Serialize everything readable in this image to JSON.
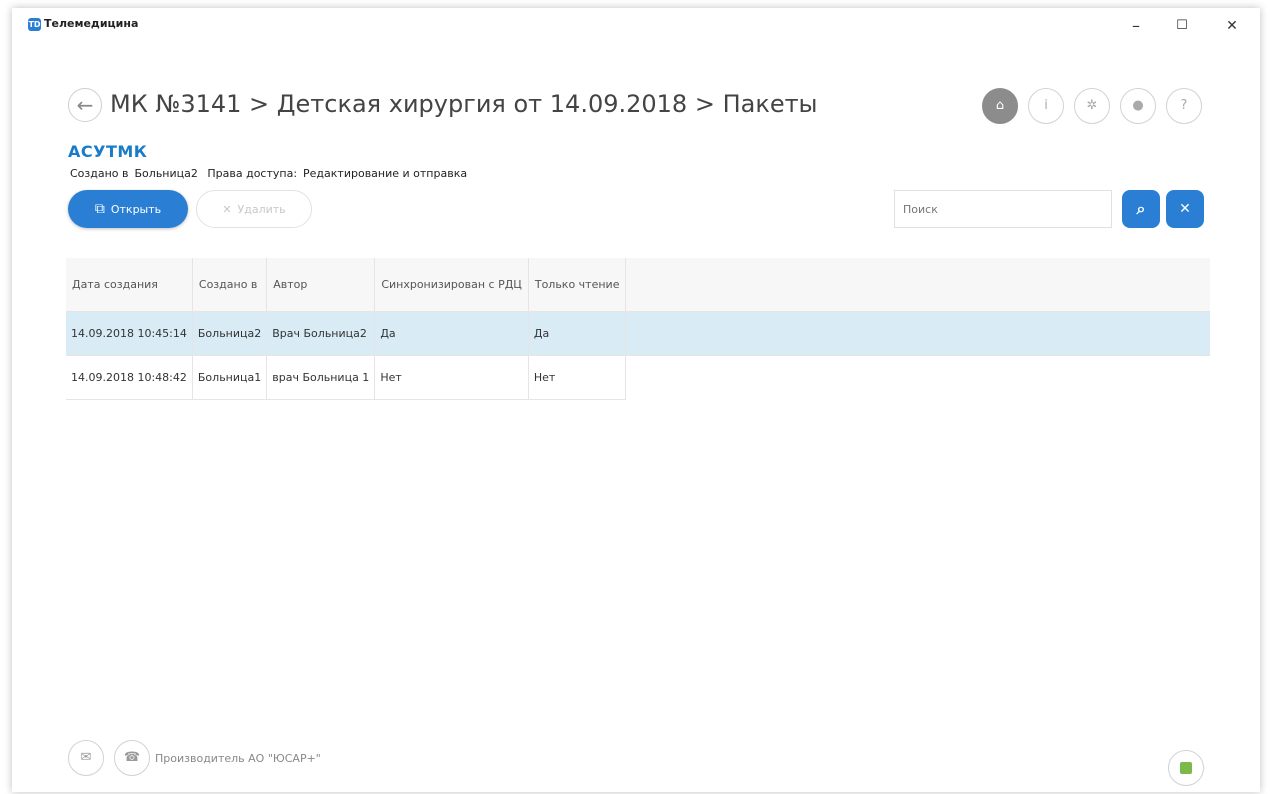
{
  "window": {
    "title": "Телемедицина",
    "app_icon": "TD",
    "minimize": "–",
    "maximize": "☐",
    "close": "✕"
  },
  "header": {
    "back": "←",
    "breadcrumb": "МК №3141 > Детская хирургия от 14.09.2018 > Пакеты",
    "icons": [
      "home-icon",
      "info-icon",
      "gear-icon",
      "user-icon",
      "help-icon"
    ],
    "icon_glyphs": [
      "⌂",
      "i",
      "✲",
      "●",
      "?"
    ]
  },
  "brand": "АСУТМК",
  "meta": {
    "created_in_label": "Создано в",
    "created_in_value": "Больница2",
    "access_label": "Права доступа:",
    "access_value": "Редактирование и отправка"
  },
  "toolbar": {
    "open_label": "Открыть",
    "open_icon": "⧉",
    "delete_label": "Удалить",
    "delete_icon": "✕",
    "search_placeholder": "Поиск",
    "search_icon": "⌕",
    "clear_icon": "✕"
  },
  "table": {
    "columns": [
      "Дата создания",
      "Создано в",
      "Автор",
      "Синхронизирован с РДЦ",
      "Только чтение"
    ],
    "rows": [
      [
        "14.09.2018 10:45:14",
        "Больница2",
        "Врач Больница2",
        "Да",
        "Да"
      ],
      [
        "14.09.2018 10:48:42",
        "Больница1",
        "врач Больница 1",
        "Нет",
        "Нет"
      ]
    ],
    "selected_row": 0
  },
  "footer": {
    "mail_icon": "✉",
    "phone_icon": "☎",
    "vendor": "Производитель АО \"ЮСАР+\""
  },
  "colors": {
    "accent": "#2a7fd4",
    "brand": "#1a7cc9",
    "selected_row": "#d9ecf6",
    "status": "#7ab94a"
  }
}
